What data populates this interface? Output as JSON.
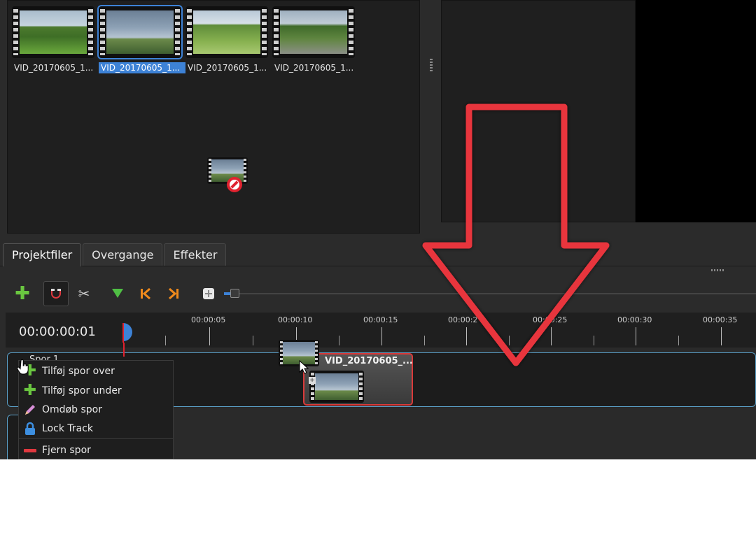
{
  "project_files": {
    "items": [
      {
        "label": "VID_20170605_1...",
        "selected": false
      },
      {
        "label": "VID_20170605_1...",
        "selected": true
      },
      {
        "label": "VID_20170605_1...",
        "selected": false
      },
      {
        "label": "VID_20170605_1...",
        "selected": false
      }
    ]
  },
  "tabs": [
    {
      "label": "Projektfiler",
      "active": true
    },
    {
      "label": "Overgange",
      "active": false
    },
    {
      "label": "Effekter",
      "active": false
    }
  ],
  "toolbar": {
    "icons": [
      "add-icon",
      "magnet-icon",
      "razor-icon",
      "marker-icon",
      "previous-marker-icon",
      "next-marker-icon",
      "center-timeline-icon"
    ],
    "zoom_level": 0.02
  },
  "timeline": {
    "timecode": "00:00:00:01",
    "ticks": [
      "00:00:05",
      "00:00:10",
      "00:00:15",
      "00:00:2",
      "00:00:25",
      "00:00:30",
      "00:00:35"
    ],
    "track_name": "Spor 1",
    "clip_title": "VID_20170605_..."
  },
  "context_menu": {
    "items": [
      {
        "label": "Tilføj spor over",
        "icon": "plus-icon"
      },
      {
        "label": "Tilføj spor under",
        "icon": "plus-icon"
      },
      {
        "label": "Omdøb spor",
        "icon": "pencil-icon"
      },
      {
        "label": "Lock Track",
        "icon": "lock-icon"
      },
      {
        "label": "Fjern spor",
        "icon": "minus-icon"
      }
    ]
  },
  "colors": {
    "selection": "#3d82d6",
    "arrow": "#e8353d",
    "clip_border": "#d93a3a",
    "track_border": "#5a9fc7"
  }
}
